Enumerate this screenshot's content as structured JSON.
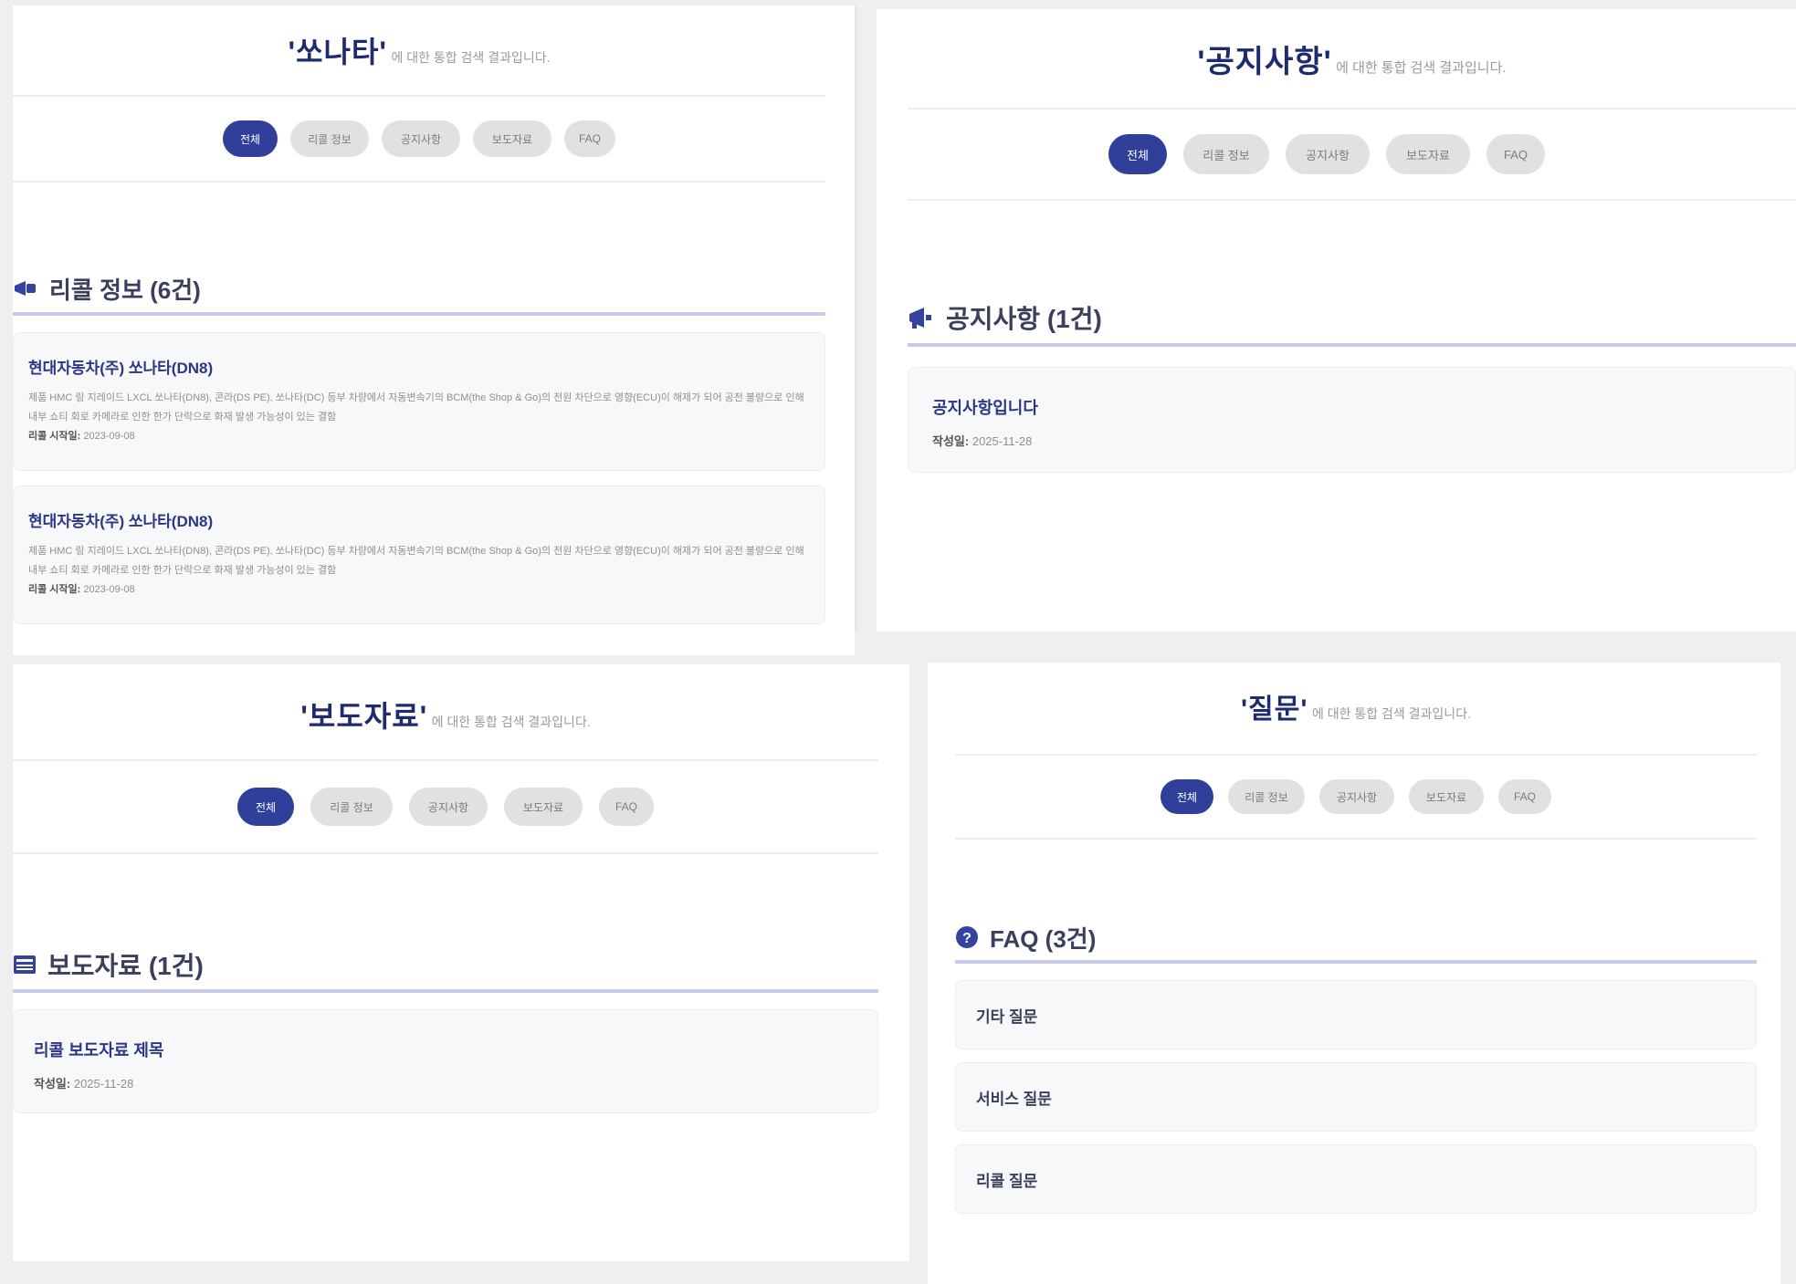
{
  "tabs": [
    "전체",
    "리콜 정보",
    "공지사항",
    "보도자료",
    "FAQ"
  ],
  "panels": {
    "sonata": {
      "keyword": "'쏘나타'",
      "suffix": "에 대한 통합 검색 결과입니다.",
      "section_title": "리콜 정보 (6건)",
      "section_icon": "megaphone-icon",
      "cards": [
        {
          "title": "현대자동차(주) 쏘나타(DN8)",
          "desc": "제품 HMC 링 지레이드 LXCL 쏘나타(DN8), 콘라(DS PE), 쏘나타(DC) 등부 차량에서 자동변속기의 BCM(the Shop & Go)의 전원 차단으로 영향(ECU)이 해제가 되어 공전 불량으로 인해 내부 쇼티 회로 카메라로 인한 한가 단락으로 화재 발생 가능성이 있는 결함",
          "date_label": "리콜 시작일:",
          "date": "2023-09-08"
        },
        {
          "title": "현대자동차(주) 쏘나타(DN8)",
          "desc": "제품 HMC 링 지레이드 LXCL 쏘나타(DN8), 콘라(DS PE), 쏘나타(DC) 등부 차량에서 자동변속기의 BCM(the Shop & Go)의 전원 차단으로 영향(ECU)이 해제가 되어 공전 불량으로 인해 내부 쇼티 회로 카메라로 인한 한가 단락으로 화재 발생 가능성이 있는 결함",
          "date_label": "리콜 시작일:",
          "date": "2023-09-08"
        }
      ]
    },
    "notice": {
      "keyword": "'공지사항'",
      "suffix": "에 대한 통합 검색 결과입니다.",
      "section_title": "공지사항 (1건)",
      "section_icon": "bullhorn-icon",
      "cards": [
        {
          "title": "공지사항입니다",
          "date_label": "작성일:",
          "date": "2025-11-28"
        }
      ]
    },
    "press": {
      "keyword": "'보도자료'",
      "suffix": "에 대한 통합 검색 결과입니다.",
      "section_title": "보도자료 (1건)",
      "section_icon": "newspaper-icon",
      "cards": [
        {
          "title": "리콜 보도자료 제목",
          "date_label": "작성일:",
          "date": "2025-11-28"
        }
      ]
    },
    "question": {
      "keyword": "'질문'",
      "suffix": "에 대한 통합 검색 결과입니다.",
      "section_title": "FAQ (3건)",
      "section_icon": "question-circle-icon",
      "items": [
        "기타 질문",
        "서비스 질문",
        "리콜 질문"
      ]
    }
  }
}
